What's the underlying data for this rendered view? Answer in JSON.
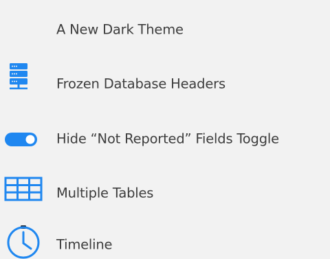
{
  "features": {
    "accent_color": "#1f87f0",
    "items": [
      {
        "icon": "crescent-moon-icon",
        "label": "A New Dark Theme"
      },
      {
        "icon": "server-database-icon",
        "label": "Frozen Database Headers"
      },
      {
        "icon": "toggle-switch-on-icon",
        "label": "Hide “Not Reported” Fields Toggle"
      },
      {
        "icon": "table-grid-icon",
        "label": "Multiple Tables"
      },
      {
        "icon": "stopwatch-clock-icon",
        "label": "Timeline"
      }
    ]
  }
}
